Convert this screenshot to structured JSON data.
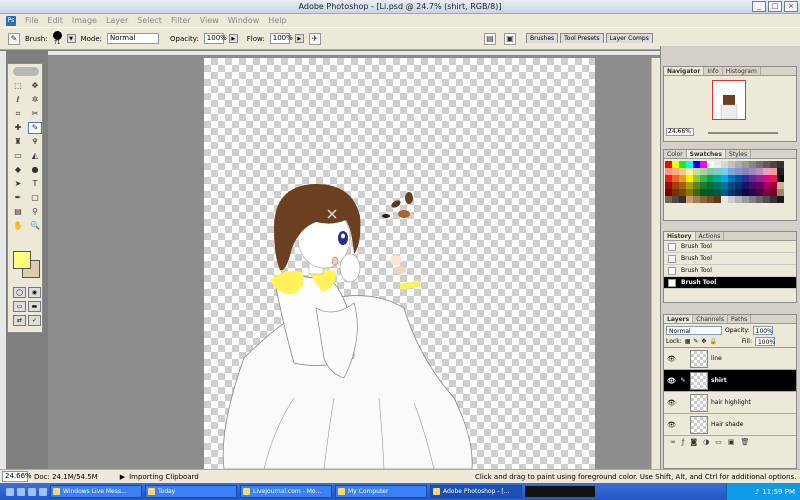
{
  "window": {
    "title": "Adobe Photoshop - [Li.psd @ 24.7% (shirt, RGB/8)]",
    "min": "_",
    "max": "□",
    "close": "×"
  },
  "menu": [
    "File",
    "Edit",
    "Image",
    "Layer",
    "Select",
    "Filter",
    "View",
    "Window",
    "Help"
  ],
  "options": {
    "brush_label": "Brush:",
    "brush_size": "71",
    "mode_label": "Mode:",
    "mode_value": "Normal",
    "opacity_label": "Opacity:",
    "opacity_value": "100%",
    "flow_label": "Flow:",
    "flow_value": "100%"
  },
  "palette_well": [
    "Brushes",
    "Tool Presets",
    "Layer Comps"
  ],
  "colors": {
    "foreground": "#ffff80",
    "background": "#dccdb0"
  },
  "navigator": {
    "tabs": [
      "Navigator",
      "Info",
      "Histogram"
    ],
    "zoom": "24.66%"
  },
  "swatches": {
    "tabs": [
      "Color",
      "Swatches",
      "Styles"
    ]
  },
  "history": {
    "tabs": [
      "History",
      "Actions"
    ],
    "items": [
      "Brush Tool",
      "Brush Tool",
      "Brush Tool",
      "Brush Tool"
    ]
  },
  "layers": {
    "tabs": [
      "Layers",
      "Channels",
      "Paths"
    ],
    "blend_mode": "Normal",
    "opacity_label": "Opacity:",
    "opacity_value": "100%",
    "lock_label": "Lock:",
    "fill_label": "Fill:",
    "fill_value": "100%",
    "items": [
      "line",
      "shirt",
      "hair highlight",
      "Hair shade"
    ]
  },
  "status": {
    "zoom": "24.66%",
    "doc": "Doc: 24.1M/54.5M",
    "message": "Importing Clipboard",
    "hint": "Click and drag to paint using foreground color.  Use Shift, Alt, and Ctrl for additional options."
  },
  "taskbar": {
    "items": [
      "Windows Live Mess...",
      "Today",
      "LiveJournal.com - Mo...",
      "My Computer",
      "Adobe Photoshop - [..."
    ],
    "clock": "11:59 PM"
  }
}
